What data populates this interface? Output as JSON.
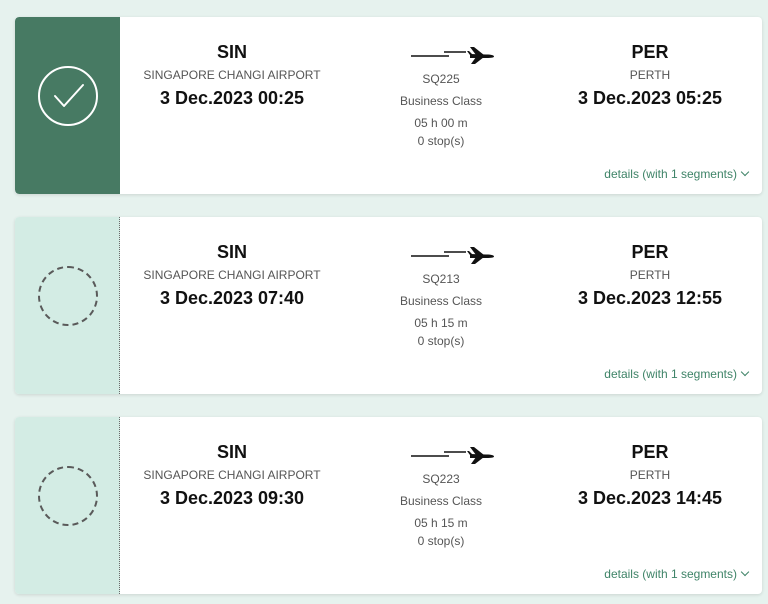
{
  "flights": [
    {
      "selected": true,
      "departure": {
        "code": "SIN",
        "airport": "SINGAPORE CHANGI AIRPORT",
        "datetime": "3 Dec.2023 00:25"
      },
      "arrival": {
        "code": "PER",
        "airport": "PERTH",
        "datetime": "3 Dec.2023 05:25"
      },
      "flight_no": "SQ225",
      "cabin": "Business Class",
      "duration": "05 h 00 m",
      "stops": "0 stop(s)",
      "details": "details (with 1 segments)"
    },
    {
      "selected": false,
      "departure": {
        "code": "SIN",
        "airport": "SINGAPORE CHANGI AIRPORT",
        "datetime": "3 Dec.2023 07:40"
      },
      "arrival": {
        "code": "PER",
        "airport": "PERTH",
        "datetime": "3 Dec.2023 12:55"
      },
      "flight_no": "SQ213",
      "cabin": "Business Class",
      "duration": "05 h 15 m",
      "stops": "0 stop(s)",
      "details": "details (with 1 segments)"
    },
    {
      "selected": false,
      "departure": {
        "code": "SIN",
        "airport": "SINGAPORE CHANGI AIRPORT",
        "datetime": "3 Dec.2023 09:30"
      },
      "arrival": {
        "code": "PER",
        "airport": "PERTH",
        "datetime": "3 Dec.2023 14:45"
      },
      "flight_no": "SQ223",
      "cabin": "Business Class",
      "duration": "05 h 15 m",
      "stops": "0 stop(s)",
      "details": "details (with 1 segments)"
    }
  ],
  "icons": {
    "selected": "checkmark-icon",
    "unselected": "radio-empty-icon",
    "plane": "airplane-icon",
    "expand": "chevron-down-icon"
  },
  "colors": {
    "selected_panel": "#477a63",
    "unselected_panel": "#d3ece4",
    "link": "#3f8468",
    "background": "#e6f2ee"
  }
}
